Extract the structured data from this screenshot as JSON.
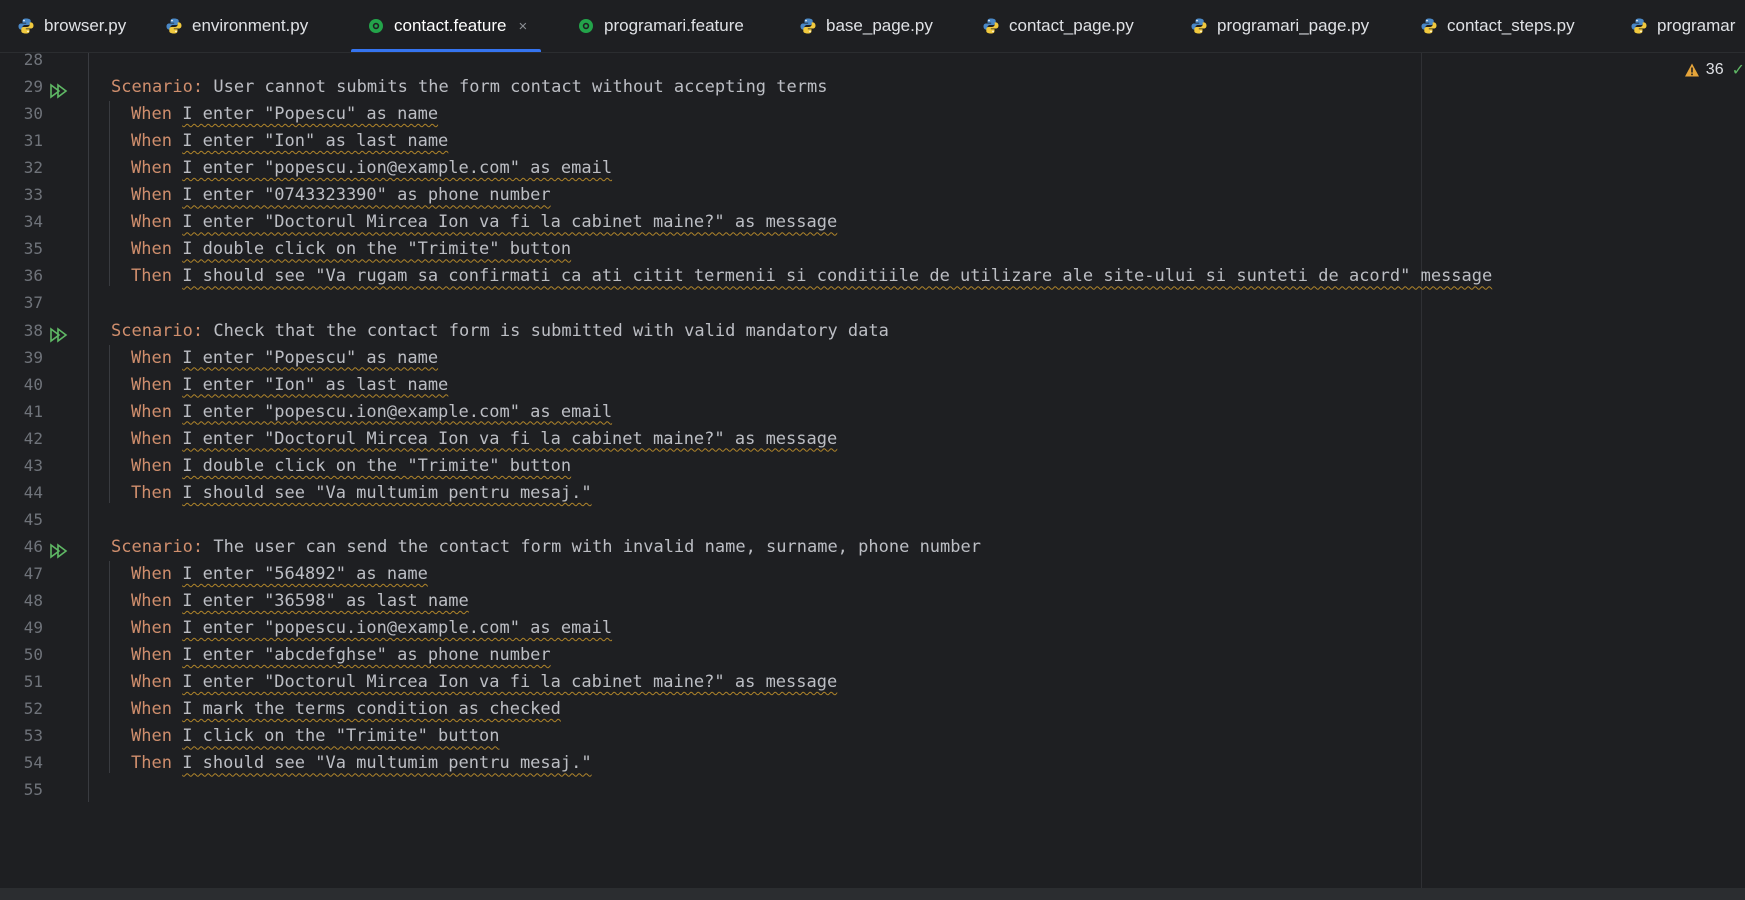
{
  "tabs": [
    {
      "label": "browser.py",
      "icon": "python-icon"
    },
    {
      "label": "environment.py",
      "icon": "python-icon"
    },
    {
      "label": "contact.feature",
      "icon": "cucumber-icon",
      "active": true,
      "close": "×"
    },
    {
      "label": "programari.feature",
      "icon": "cucumber-icon"
    },
    {
      "label": "base_page.py",
      "icon": "python-icon"
    },
    {
      "label": "contact_page.py",
      "icon": "python-icon"
    },
    {
      "label": "programari_page.py",
      "icon": "python-icon"
    },
    {
      "label": "contact_steps.py",
      "icon": "python-icon"
    },
    {
      "label": "programar",
      "icon": "python-icon"
    }
  ],
  "inspections": {
    "warnings": "36",
    "warning_icon": "warning-triangle-icon",
    "ok_icon": "check-icon"
  },
  "colors": {
    "keyword": "#cf8e6d",
    "text": "#bcbec4",
    "line_number": "#6f737a",
    "background": "#1e1f22",
    "accent": "#3574f0",
    "squiggle": "#b0852a",
    "run_icon": "#5fb865"
  },
  "lines": [
    {
      "num": "28",
      "kind": "blank"
    },
    {
      "num": "29",
      "kind": "scenario",
      "run": true,
      "keyword": "Scenario:",
      "text": " User cannot submits the form contact without accepting terms"
    },
    {
      "num": "30",
      "kind": "step",
      "keyword": "When ",
      "text": "I enter \"Popescu\" as name"
    },
    {
      "num": "31",
      "kind": "step",
      "keyword": "When ",
      "text": "I enter \"Ion\" as last name"
    },
    {
      "num": "32",
      "kind": "step",
      "keyword": "When ",
      "text": "I enter \"popescu.ion@example.com\" as email"
    },
    {
      "num": "33",
      "kind": "step",
      "keyword": "When ",
      "text": "I enter \"0743323390\" as phone number"
    },
    {
      "num": "34",
      "kind": "step",
      "keyword": "When ",
      "text": "I enter \"Doctorul Mircea Ion va fi la cabinet maine?\" as message"
    },
    {
      "num": "35",
      "kind": "step",
      "keyword": "When ",
      "text": "I double click on the \"Trimite\" button"
    },
    {
      "num": "36",
      "kind": "step",
      "keyword": "Then ",
      "text": "I should see \"Va rugam sa confirmati ca ati citit termenii si conditiile de utilizare ale site-ului si sunteti de acord\" message"
    },
    {
      "num": "37",
      "kind": "blank"
    },
    {
      "num": "38",
      "kind": "scenario",
      "run": true,
      "keyword": "Scenario:",
      "text": " Check that the contact form is submitted with valid mandatory data"
    },
    {
      "num": "39",
      "kind": "step",
      "keyword": "When ",
      "text": "I enter \"Popescu\" as name"
    },
    {
      "num": "40",
      "kind": "step",
      "keyword": "When ",
      "text": "I enter \"Ion\" as last name"
    },
    {
      "num": "41",
      "kind": "step",
      "keyword": "When ",
      "text": "I enter \"popescu.ion@example.com\" as email"
    },
    {
      "num": "42",
      "kind": "step",
      "keyword": "When ",
      "text": "I enter \"Doctorul Mircea Ion va fi la cabinet maine?\" as message"
    },
    {
      "num": "43",
      "kind": "step",
      "keyword": "When ",
      "text": "I double click on the \"Trimite\" button"
    },
    {
      "num": "44",
      "kind": "step",
      "keyword": "Then ",
      "text": "I should see \"Va multumim pentru mesaj.\""
    },
    {
      "num": "45",
      "kind": "blank"
    },
    {
      "num": "46",
      "kind": "scenario",
      "run": true,
      "keyword": "Scenario:",
      "text": " The user can send the contact form with invalid name, surname, phone number"
    },
    {
      "num": "47",
      "kind": "step",
      "keyword": "When ",
      "text": "I enter \"564892\" as name"
    },
    {
      "num": "48",
      "kind": "step",
      "keyword": "When ",
      "text": "I enter \"36598\" as last name"
    },
    {
      "num": "49",
      "kind": "step",
      "keyword": "When ",
      "text": "I enter \"popescu.ion@example.com\" as email"
    },
    {
      "num": "50",
      "kind": "step",
      "keyword": "When ",
      "text": "I enter \"abcdefghse\" as phone number"
    },
    {
      "num": "51",
      "kind": "step",
      "keyword": "When ",
      "text": "I enter \"Doctorul Mircea Ion va fi la cabinet maine?\" as message"
    },
    {
      "num": "52",
      "kind": "step",
      "keyword": "When ",
      "text": "I mark the terms condition as checked"
    },
    {
      "num": "53",
      "kind": "step",
      "keyword": "When ",
      "text": "I click on the \"Trimite\" button"
    },
    {
      "num": "54",
      "kind": "step",
      "keyword": "Then ",
      "text": "I should see \"Va multumim pentru mesaj.\""
    },
    {
      "num": "55",
      "kind": "blank"
    }
  ]
}
